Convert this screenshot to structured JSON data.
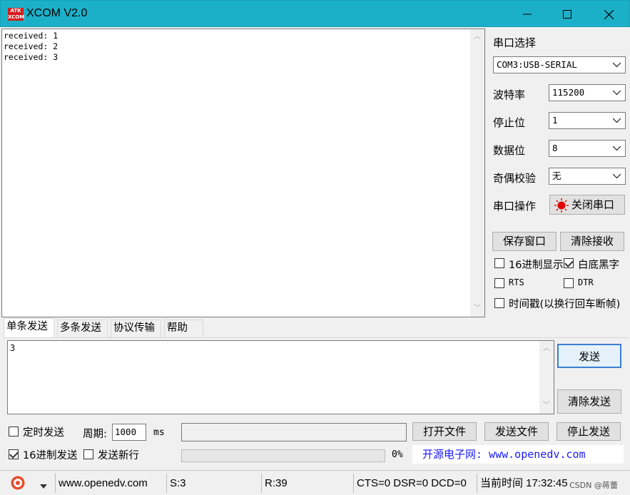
{
  "window": {
    "title": "XCOM V2.0",
    "logo_text_top": "ATK",
    "logo_text_bottom": "XCOM"
  },
  "receive": {
    "text": "received: 1\nreceived: 2\nreceived: 3"
  },
  "serial": {
    "port_select_label": "串口选择",
    "port_value": "COM3:USB-SERIAL",
    "baud_label": "波特率",
    "baud_value": "115200",
    "stop_label": "停止位",
    "stop_value": "1",
    "data_label": "数据位",
    "data_value": "8",
    "parity_label": "奇偶校验",
    "parity_value": "无",
    "op_label": "串口操作",
    "close_button": "关闭串口",
    "status_color": "#e00000"
  },
  "options": {
    "save_window": "保存窗口",
    "clear_recv": "清除接收",
    "hex_display": "16进制显示",
    "white_black": "白底黑字",
    "rts": "RTS",
    "dtr": "DTR",
    "timestamp": "时间戳(以换行回车断帧)",
    "hex_display_checked": false,
    "white_black_checked": true,
    "rts_checked": false,
    "dtr_checked": false,
    "timestamp_checked": false
  },
  "tabs": [
    {
      "label": "单条发送",
      "active": true
    },
    {
      "label": "多条发送",
      "active": false
    },
    {
      "label": "协议传输",
      "active": false
    },
    {
      "label": "帮助",
      "active": false
    }
  ],
  "send": {
    "text": "3",
    "send_button": "发送",
    "clear_send_button": "清除发送",
    "timed_send": "定时发送",
    "period_label": "周期:",
    "period_value": "1000",
    "period_unit": "ms",
    "open_file": "打开文件",
    "send_file": "发送文件",
    "stop_send": "停止发送",
    "hex_send": "16进制发送",
    "send_newline": "发送新行",
    "progress_text": "0%",
    "progress": 0,
    "timed_send_checked": false,
    "hex_send_checked": true,
    "send_newline_checked": false,
    "banner": "开源电子网: www.openedv.com"
  },
  "statusbar": {
    "website": "www.openedv.com",
    "sent": "S:3",
    "received": "R:39",
    "signals": "CTS=0 DSR=0 DCD=0",
    "time": "当前时间 17:32:45",
    "watermark": "CSDN @蒋蕾"
  }
}
